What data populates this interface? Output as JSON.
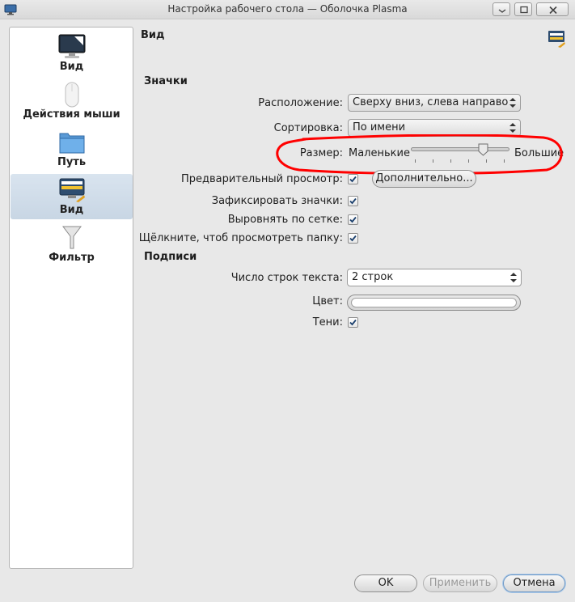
{
  "window": {
    "title": "Настройка рабочего стола — Оболочка Plasma"
  },
  "sidebar": {
    "items": [
      {
        "label": "Вид",
        "icon": "monitor-icon"
      },
      {
        "label": "Действия мыши",
        "icon": "mouse-icon"
      },
      {
        "label": "Путь",
        "icon": "folder-icon"
      },
      {
        "label": "Вид",
        "icon": "view-icon",
        "active": true
      },
      {
        "label": "Фильтр",
        "icon": "funnel-icon"
      }
    ]
  },
  "page": {
    "title": "Вид"
  },
  "icons": {
    "section": "Значки",
    "arrangement_label": "Расположение:",
    "arrangement_value": "Сверху вниз, слева направо",
    "sorting_label": "Сортировка:",
    "sorting_value": "По имени",
    "size_label": "Размер:",
    "size_min": "Маленькие",
    "size_max": "Большие",
    "size_level": 0.75,
    "preview_label": "Предварительный просмотр:",
    "preview_checked": true,
    "more_button": "Дополнительно...",
    "lock_label": "Зафиксировать значки:",
    "lock_checked": true,
    "align_label": "Выровнять по сетке:",
    "align_checked": true,
    "click_label": "Щёлкните, чтоб просмотреть папку:",
    "click_checked": true
  },
  "captions": {
    "section": "Подписи",
    "lines_label": "Число строк текста:",
    "lines_value": "2 строк",
    "color_label": "Цвет:",
    "color_value": "#ffffff",
    "shadows_label": "Тени:",
    "shadows_checked": true
  },
  "footer": {
    "ok": "OK",
    "apply": "Применить",
    "cancel": "Отмена"
  },
  "colors": {
    "annotation": "#ff0000",
    "accent": "#3d8ee0"
  }
}
